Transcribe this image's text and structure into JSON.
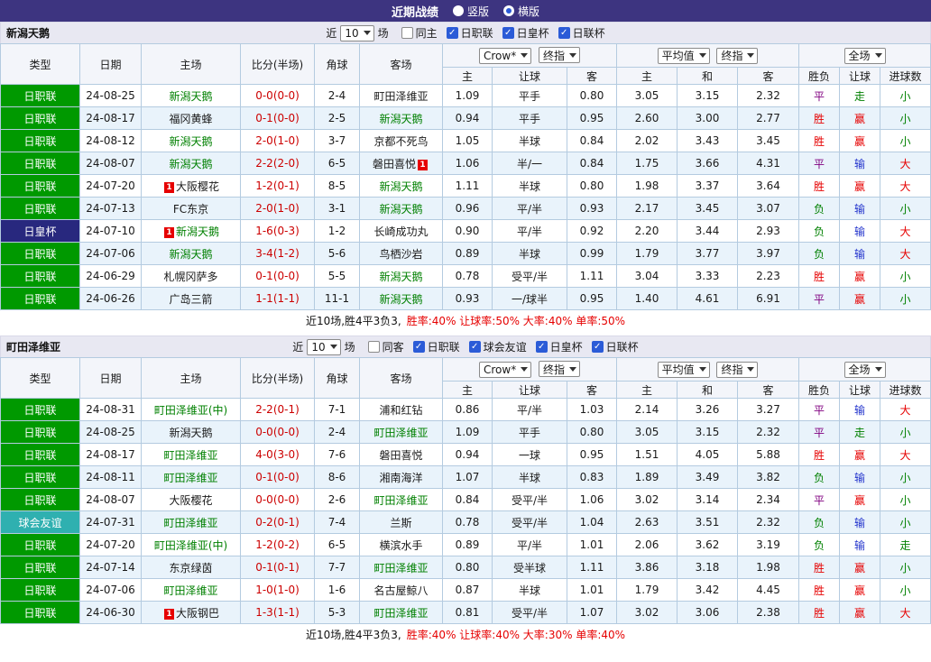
{
  "palette": {
    "topbar_bg": "#3d3480",
    "accent_blue": "#2b5bd7",
    "section_bar_bg": "#e8e8f2",
    "table_header_bg": "#f3f5fa",
    "grid_border": "#b4cbe0",
    "row_alt_bg": "#e9f3fb",
    "type_league": "#009900",
    "type_cup": "#28287e",
    "type_friendly": "#2fb0b0",
    "focus_team": "#008000",
    "score": "#cc0000",
    "red": "#e60000",
    "green": "#008000",
    "blue": "#2233cc",
    "purple": "#800080",
    "stats": "#e60000"
  },
  "topbar": {
    "title": "近期战绩",
    "radios": [
      {
        "label": "竖版",
        "selected": false
      },
      {
        "label": "横版",
        "selected": true
      }
    ]
  },
  "labels": {
    "near": "近",
    "games": "场"
  },
  "table_header": {
    "type": "类型",
    "date": "日期",
    "home": "主场",
    "score": "比分(半场)",
    "corners": "角球",
    "away": "客场",
    "bookmaker_select": "Crow*",
    "final_select": "终指",
    "average_select": "平均值",
    "average_final_select": "终指",
    "fulltime_select": "全场",
    "sub": [
      "主",
      "让球",
      "客",
      "主",
      "和",
      "客",
      "胜负",
      "让球",
      "进球数"
    ]
  },
  "sections": [
    {
      "team": "新潟天鹅",
      "count": "10",
      "checkboxes": [
        {
          "label": "同主",
          "checked": false
        },
        {
          "label": "日职联",
          "checked": true
        },
        {
          "label": "日皇杯",
          "checked": true
        },
        {
          "label": "日联杯",
          "checked": true
        }
      ],
      "rows": [
        {
          "type": {
            "text": "日职联",
            "c": "league"
          },
          "date": "24-08-25",
          "home": {
            "name": "新潟天鹅",
            "focus": true
          },
          "score": "0-0(0-0)",
          "corners": "2-4",
          "away": {
            "name": "町田泽维亚",
            "focus": false
          },
          "odds": [
            "1.09",
            "平手",
            "0.80"
          ],
          "avg": [
            "3.05",
            "3.15",
            "2.32"
          ],
          "res": {
            "text": "平",
            "c": "purple"
          },
          "let": {
            "text": "走",
            "c": "green"
          },
          "goal": {
            "text": "小",
            "c": "green"
          }
        },
        {
          "type": {
            "text": "日职联",
            "c": "league"
          },
          "date": "24-08-17",
          "home": {
            "name": "福冈黄蜂",
            "focus": false
          },
          "score": "0-1(0-0)",
          "corners": "2-5",
          "away": {
            "name": "新潟天鹅",
            "focus": true
          },
          "odds": [
            "0.94",
            "平手",
            "0.95"
          ],
          "avg": [
            "2.60",
            "3.00",
            "2.77"
          ],
          "res": {
            "text": "胜",
            "c": "red"
          },
          "let": {
            "text": "赢",
            "c": "red"
          },
          "goal": {
            "text": "小",
            "c": "green"
          }
        },
        {
          "type": {
            "text": "日职联",
            "c": "league"
          },
          "date": "24-08-12",
          "home": {
            "name": "新潟天鹅",
            "focus": true
          },
          "score": "2-0(1-0)",
          "corners": "3-7",
          "away": {
            "name": "京都不死鸟",
            "focus": false
          },
          "odds": [
            "1.05",
            "半球",
            "0.84"
          ],
          "avg": [
            "2.02",
            "3.43",
            "3.45"
          ],
          "res": {
            "text": "胜",
            "c": "red"
          },
          "let": {
            "text": "赢",
            "c": "red"
          },
          "goal": {
            "text": "小",
            "c": "green"
          }
        },
        {
          "type": {
            "text": "日职联",
            "c": "league"
          },
          "date": "24-08-07",
          "home": {
            "name": "新潟天鹅",
            "focus": true
          },
          "score": "2-2(2-0)",
          "corners": "6-5",
          "away": {
            "name": "磐田喜悦",
            "focus": false,
            "badge": {
              "pos": "right",
              "text": "1"
            }
          },
          "odds": [
            "1.06",
            "半/一",
            "0.84"
          ],
          "avg": [
            "1.75",
            "3.66",
            "4.31"
          ],
          "res": {
            "text": "平",
            "c": "purple"
          },
          "let": {
            "text": "输",
            "c": "blue"
          },
          "goal": {
            "text": "大",
            "c": "red"
          }
        },
        {
          "type": {
            "text": "日职联",
            "c": "league"
          },
          "date": "24-07-20",
          "home": {
            "name": "大阪樱花",
            "focus": false,
            "badge": {
              "pos": "left",
              "text": "1"
            }
          },
          "score": "1-2(0-1)",
          "corners": "8-5",
          "away": {
            "name": "新潟天鹅",
            "focus": true
          },
          "odds": [
            "1.11",
            "半球",
            "0.80"
          ],
          "avg": [
            "1.98",
            "3.37",
            "3.64"
          ],
          "res": {
            "text": "胜",
            "c": "red"
          },
          "let": {
            "text": "赢",
            "c": "red"
          },
          "goal": {
            "text": "大",
            "c": "red"
          }
        },
        {
          "type": {
            "text": "日职联",
            "c": "league"
          },
          "date": "24-07-13",
          "home": {
            "name": "FC东京",
            "focus": false
          },
          "score": "2-0(1-0)",
          "corners": "3-1",
          "away": {
            "name": "新潟天鹅",
            "focus": true
          },
          "odds": [
            "0.96",
            "平/半",
            "0.93"
          ],
          "avg": [
            "2.17",
            "3.45",
            "3.07"
          ],
          "res": {
            "text": "负",
            "c": "green"
          },
          "let": {
            "text": "输",
            "c": "blue"
          },
          "goal": {
            "text": "小",
            "c": "green"
          }
        },
        {
          "type": {
            "text": "日皇杯",
            "c": "cup"
          },
          "date": "24-07-10",
          "home": {
            "name": "新潟天鹅",
            "focus": true,
            "badge": {
              "pos": "left",
              "text": "1"
            }
          },
          "score": "1-6(0-3)",
          "corners": "1-2",
          "away": {
            "name": "长崎成功丸",
            "focus": false
          },
          "odds": [
            "0.90",
            "平/半",
            "0.92"
          ],
          "avg": [
            "2.20",
            "3.44",
            "2.93"
          ],
          "res": {
            "text": "负",
            "c": "green"
          },
          "let": {
            "text": "输",
            "c": "blue"
          },
          "goal": {
            "text": "大",
            "c": "red"
          }
        },
        {
          "type": {
            "text": "日职联",
            "c": "league"
          },
          "date": "24-07-06",
          "home": {
            "name": "新潟天鹅",
            "focus": true
          },
          "score": "3-4(1-2)",
          "corners": "5-6",
          "away": {
            "name": "鸟栖沙岩",
            "focus": false
          },
          "odds": [
            "0.89",
            "半球",
            "0.99"
          ],
          "avg": [
            "1.79",
            "3.77",
            "3.97"
          ],
          "res": {
            "text": "负",
            "c": "green"
          },
          "let": {
            "text": "输",
            "c": "blue"
          },
          "goal": {
            "text": "大",
            "c": "red"
          }
        },
        {
          "type": {
            "text": "日职联",
            "c": "league"
          },
          "date": "24-06-29",
          "home": {
            "name": "札幌冈萨多",
            "focus": false
          },
          "score": "0-1(0-0)",
          "corners": "5-5",
          "away": {
            "name": "新潟天鹅",
            "focus": true
          },
          "odds": [
            "0.78",
            "受平/半",
            "1.11"
          ],
          "avg": [
            "3.04",
            "3.33",
            "2.23"
          ],
          "res": {
            "text": "胜",
            "c": "red"
          },
          "let": {
            "text": "赢",
            "c": "red"
          },
          "goal": {
            "text": "小",
            "c": "green"
          }
        },
        {
          "type": {
            "text": "日职联",
            "c": "league"
          },
          "date": "24-06-26",
          "home": {
            "name": "广岛三箭",
            "focus": false
          },
          "score": "1-1(1-1)",
          "corners": "11-1",
          "away": {
            "name": "新潟天鹅",
            "focus": true
          },
          "odds": [
            "0.93",
            "一/球半",
            "0.95"
          ],
          "avg": [
            "1.40",
            "4.61",
            "6.91"
          ],
          "res": {
            "text": "平",
            "c": "purple"
          },
          "let": {
            "text": "赢",
            "c": "red"
          },
          "goal": {
            "text": "小",
            "c": "green"
          }
        }
      ],
      "footer": {
        "prefix": "近10场,胜4平3负3,",
        "stats": "胜率:40% 让球率:50% 大率:40% 单率:50%"
      }
    },
    {
      "team": "町田泽维亚",
      "count": "10",
      "checkboxes": [
        {
          "label": "同客",
          "checked": false
        },
        {
          "label": "日职联",
          "checked": true
        },
        {
          "label": "球会友谊",
          "checked": true
        },
        {
          "label": "日皇杯",
          "checked": true
        },
        {
          "label": "日联杯",
          "checked": true
        }
      ],
      "rows": [
        {
          "type": {
            "text": "日职联",
            "c": "league"
          },
          "date": "24-08-31",
          "home": {
            "name": "町田泽维亚(中)",
            "focus": true
          },
          "score": "2-2(0-1)",
          "corners": "7-1",
          "away": {
            "name": "浦和红钻",
            "focus": false
          },
          "odds": [
            "0.86",
            "平/半",
            "1.03"
          ],
          "avg": [
            "2.14",
            "3.26",
            "3.27"
          ],
          "res": {
            "text": "平",
            "c": "purple"
          },
          "let": {
            "text": "输",
            "c": "blue"
          },
          "goal": {
            "text": "大",
            "c": "red"
          }
        },
        {
          "type": {
            "text": "日职联",
            "c": "league"
          },
          "date": "24-08-25",
          "home": {
            "name": "新潟天鹅",
            "focus": false
          },
          "score": "0-0(0-0)",
          "corners": "2-4",
          "away": {
            "name": "町田泽维亚",
            "focus": true
          },
          "odds": [
            "1.09",
            "平手",
            "0.80"
          ],
          "avg": [
            "3.05",
            "3.15",
            "2.32"
          ],
          "res": {
            "text": "平",
            "c": "purple"
          },
          "let": {
            "text": "走",
            "c": "green"
          },
          "goal": {
            "text": "小",
            "c": "green"
          }
        },
        {
          "type": {
            "text": "日职联",
            "c": "league"
          },
          "date": "24-08-17",
          "home": {
            "name": "町田泽维亚",
            "focus": true
          },
          "score": "4-0(3-0)",
          "corners": "7-6",
          "away": {
            "name": "磐田喜悦",
            "focus": false
          },
          "odds": [
            "0.94",
            "一球",
            "0.95"
          ],
          "avg": [
            "1.51",
            "4.05",
            "5.88"
          ],
          "res": {
            "text": "胜",
            "c": "red"
          },
          "let": {
            "text": "赢",
            "c": "red"
          },
          "goal": {
            "text": "大",
            "c": "red"
          }
        },
        {
          "type": {
            "text": "日职联",
            "c": "league"
          },
          "date": "24-08-11",
          "home": {
            "name": "町田泽维亚",
            "focus": true
          },
          "score": "0-1(0-0)",
          "corners": "8-6",
          "away": {
            "name": "湘南海洋",
            "focus": false
          },
          "odds": [
            "1.07",
            "半球",
            "0.83"
          ],
          "avg": [
            "1.89",
            "3.49",
            "3.82"
          ],
          "res": {
            "text": "负",
            "c": "green"
          },
          "let": {
            "text": "输",
            "c": "blue"
          },
          "goal": {
            "text": "小",
            "c": "green"
          }
        },
        {
          "type": {
            "text": "日职联",
            "c": "league"
          },
          "date": "24-08-07",
          "home": {
            "name": "大阪樱花",
            "focus": false
          },
          "score": "0-0(0-0)",
          "corners": "2-6",
          "away": {
            "name": "町田泽维亚",
            "focus": true
          },
          "odds": [
            "0.84",
            "受平/半",
            "1.06"
          ],
          "avg": [
            "3.02",
            "3.14",
            "2.34"
          ],
          "res": {
            "text": "平",
            "c": "purple"
          },
          "let": {
            "text": "赢",
            "c": "red"
          },
          "goal": {
            "text": "小",
            "c": "green"
          }
        },
        {
          "type": {
            "text": "球会友谊",
            "c": "friendly"
          },
          "date": "24-07-31",
          "home": {
            "name": "町田泽维亚",
            "focus": true
          },
          "score": "0-2(0-1)",
          "corners": "7-4",
          "away": {
            "name": "兰斯",
            "focus": false
          },
          "odds": [
            "0.78",
            "受平/半",
            "1.04"
          ],
          "avg": [
            "2.63",
            "3.51",
            "2.32"
          ],
          "res": {
            "text": "负",
            "c": "green"
          },
          "let": {
            "text": "输",
            "c": "blue"
          },
          "goal": {
            "text": "小",
            "c": "green"
          }
        },
        {
          "type": {
            "text": "日职联",
            "c": "league"
          },
          "date": "24-07-20",
          "home": {
            "name": "町田泽维亚(中)",
            "focus": true
          },
          "score": "1-2(0-2)",
          "corners": "6-5",
          "away": {
            "name": "横滨水手",
            "focus": false
          },
          "odds": [
            "0.89",
            "平/半",
            "1.01"
          ],
          "avg": [
            "2.06",
            "3.62",
            "3.19"
          ],
          "res": {
            "text": "负",
            "c": "green"
          },
          "let": {
            "text": "输",
            "c": "blue"
          },
          "goal": {
            "text": "走",
            "c": "green"
          }
        },
        {
          "type": {
            "text": "日职联",
            "c": "league"
          },
          "date": "24-07-14",
          "home": {
            "name": "东京绿茵",
            "focus": false
          },
          "score": "0-1(0-1)",
          "corners": "7-7",
          "away": {
            "name": "町田泽维亚",
            "focus": true
          },
          "odds": [
            "0.80",
            "受半球",
            "1.11"
          ],
          "avg": [
            "3.86",
            "3.18",
            "1.98"
          ],
          "res": {
            "text": "胜",
            "c": "red"
          },
          "let": {
            "text": "赢",
            "c": "red"
          },
          "goal": {
            "text": "小",
            "c": "green"
          }
        },
        {
          "type": {
            "text": "日职联",
            "c": "league"
          },
          "date": "24-07-06",
          "home": {
            "name": "町田泽维亚",
            "focus": true
          },
          "score": "1-0(1-0)",
          "corners": "1-6",
          "away": {
            "name": "名古屋鲸八",
            "focus": false
          },
          "odds": [
            "0.87",
            "半球",
            "1.01"
          ],
          "avg": [
            "1.79",
            "3.42",
            "4.45"
          ],
          "res": {
            "text": "胜",
            "c": "red"
          },
          "let": {
            "text": "赢",
            "c": "red"
          },
          "goal": {
            "text": "小",
            "c": "green"
          }
        },
        {
          "type": {
            "text": "日职联",
            "c": "league"
          },
          "date": "24-06-30",
          "home": {
            "name": "大阪钢巴",
            "focus": false,
            "badge": {
              "pos": "left",
              "text": "1"
            }
          },
          "score": "1-3(1-1)",
          "corners": "5-3",
          "away": {
            "name": "町田泽维亚",
            "focus": true
          },
          "odds": [
            "0.81",
            "受平/半",
            "1.07"
          ],
          "avg": [
            "3.02",
            "3.06",
            "2.38"
          ],
          "res": {
            "text": "胜",
            "c": "red"
          },
          "let": {
            "text": "赢",
            "c": "red"
          },
          "goal": {
            "text": "大",
            "c": "red"
          }
        }
      ],
      "footer": {
        "prefix": "近10场,胜4平3负3,",
        "stats": "胜率:40% 让球率:40% 大率:30% 单率:40%"
      }
    }
  ]
}
